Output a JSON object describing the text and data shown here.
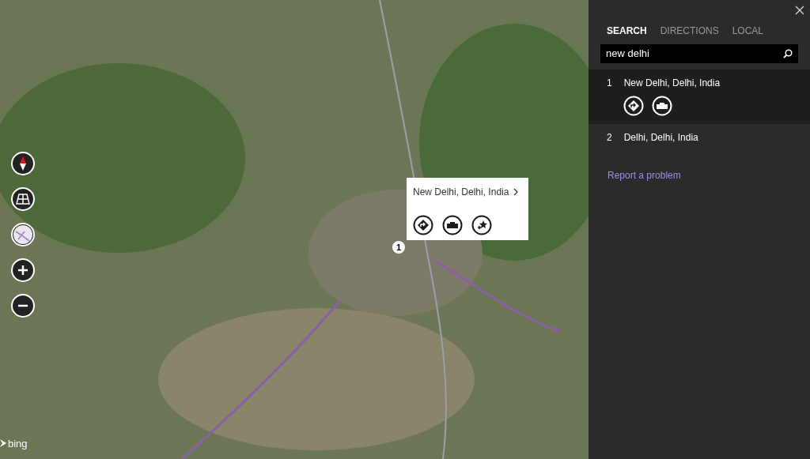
{
  "map": {
    "pin": {
      "label": "1"
    },
    "popup": {
      "title": "New Delhi, Delhi, India"
    },
    "logo": "bing"
  },
  "sidebar": {
    "tabs": [
      {
        "label": "SEARCH",
        "selected": true
      },
      {
        "label": "DIRECTIONS",
        "selected": false
      },
      {
        "label": "LOCAL",
        "selected": false
      }
    ],
    "search": {
      "value": "new delhi"
    },
    "results": [
      {
        "number": "1",
        "name": "New Delhi, Delhi, India",
        "expanded": true
      },
      {
        "number": "2",
        "name": "Delhi, Delhi, India",
        "expanded": false
      }
    ],
    "link": "Report a problem"
  }
}
